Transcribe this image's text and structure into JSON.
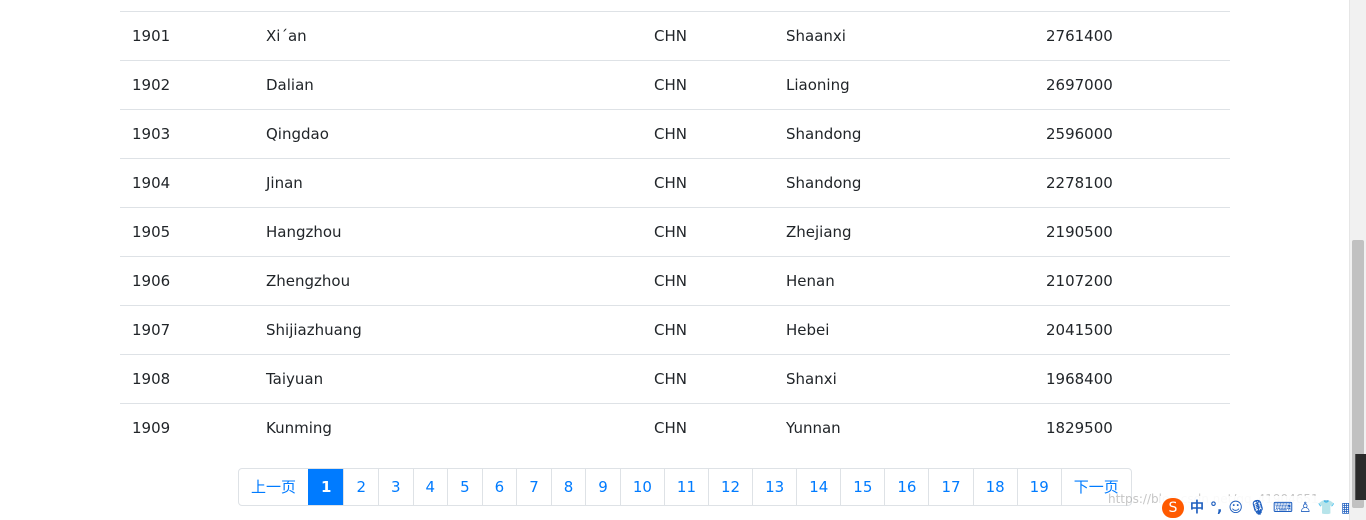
{
  "table": {
    "rows": [
      {
        "id": "1901",
        "name": "Xi´an",
        "code": "CHN",
        "district": "Shaanxi",
        "population": "2761400"
      },
      {
        "id": "1902",
        "name": "Dalian",
        "code": "CHN",
        "district": "Liaoning",
        "population": "2697000"
      },
      {
        "id": "1903",
        "name": "Qingdao",
        "code": "CHN",
        "district": "Shandong",
        "population": "2596000"
      },
      {
        "id": "1904",
        "name": "Jinan",
        "code": "CHN",
        "district": "Shandong",
        "population": "2278100"
      },
      {
        "id": "1905",
        "name": "Hangzhou",
        "code": "CHN",
        "district": "Zhejiang",
        "population": "2190500"
      },
      {
        "id": "1906",
        "name": "Zhengzhou",
        "code": "CHN",
        "district": "Henan",
        "population": "2107200"
      },
      {
        "id": "1907",
        "name": "Shijiazhuang",
        "code": "CHN",
        "district": "Hebei",
        "population": "2041500"
      },
      {
        "id": "1908",
        "name": "Taiyuan",
        "code": "CHN",
        "district": "Shanxi",
        "population": "1968400"
      },
      {
        "id": "1909",
        "name": "Kunming",
        "code": "CHN",
        "district": "Yunnan",
        "population": "1829500"
      }
    ]
  },
  "pagination": {
    "prev_label": "上一页",
    "next_label": "下一页",
    "pages": [
      "1",
      "2",
      "3",
      "4",
      "5",
      "6",
      "7",
      "8",
      "9",
      "10",
      "11",
      "12",
      "13",
      "14",
      "15",
      "16",
      "17",
      "18",
      "19"
    ],
    "active_page": "1"
  },
  "watermark": "https://blog.csdn.net/qq_41904651",
  "ime": {
    "logo": "S",
    "lang": "中",
    "punct": "°,",
    "emoji_icon": "smile-icon",
    "voice_icon": "microphone-icon",
    "keyboard_icon": "keyboard-icon",
    "user_icon": "person-icon",
    "skin_icon": "shirt-icon",
    "menu_icon": "grid-icon"
  },
  "colors": {
    "link": "#007bff",
    "active_bg": "#007bff",
    "border": "#dee2e6",
    "ime_brand": "#ff5a00"
  }
}
